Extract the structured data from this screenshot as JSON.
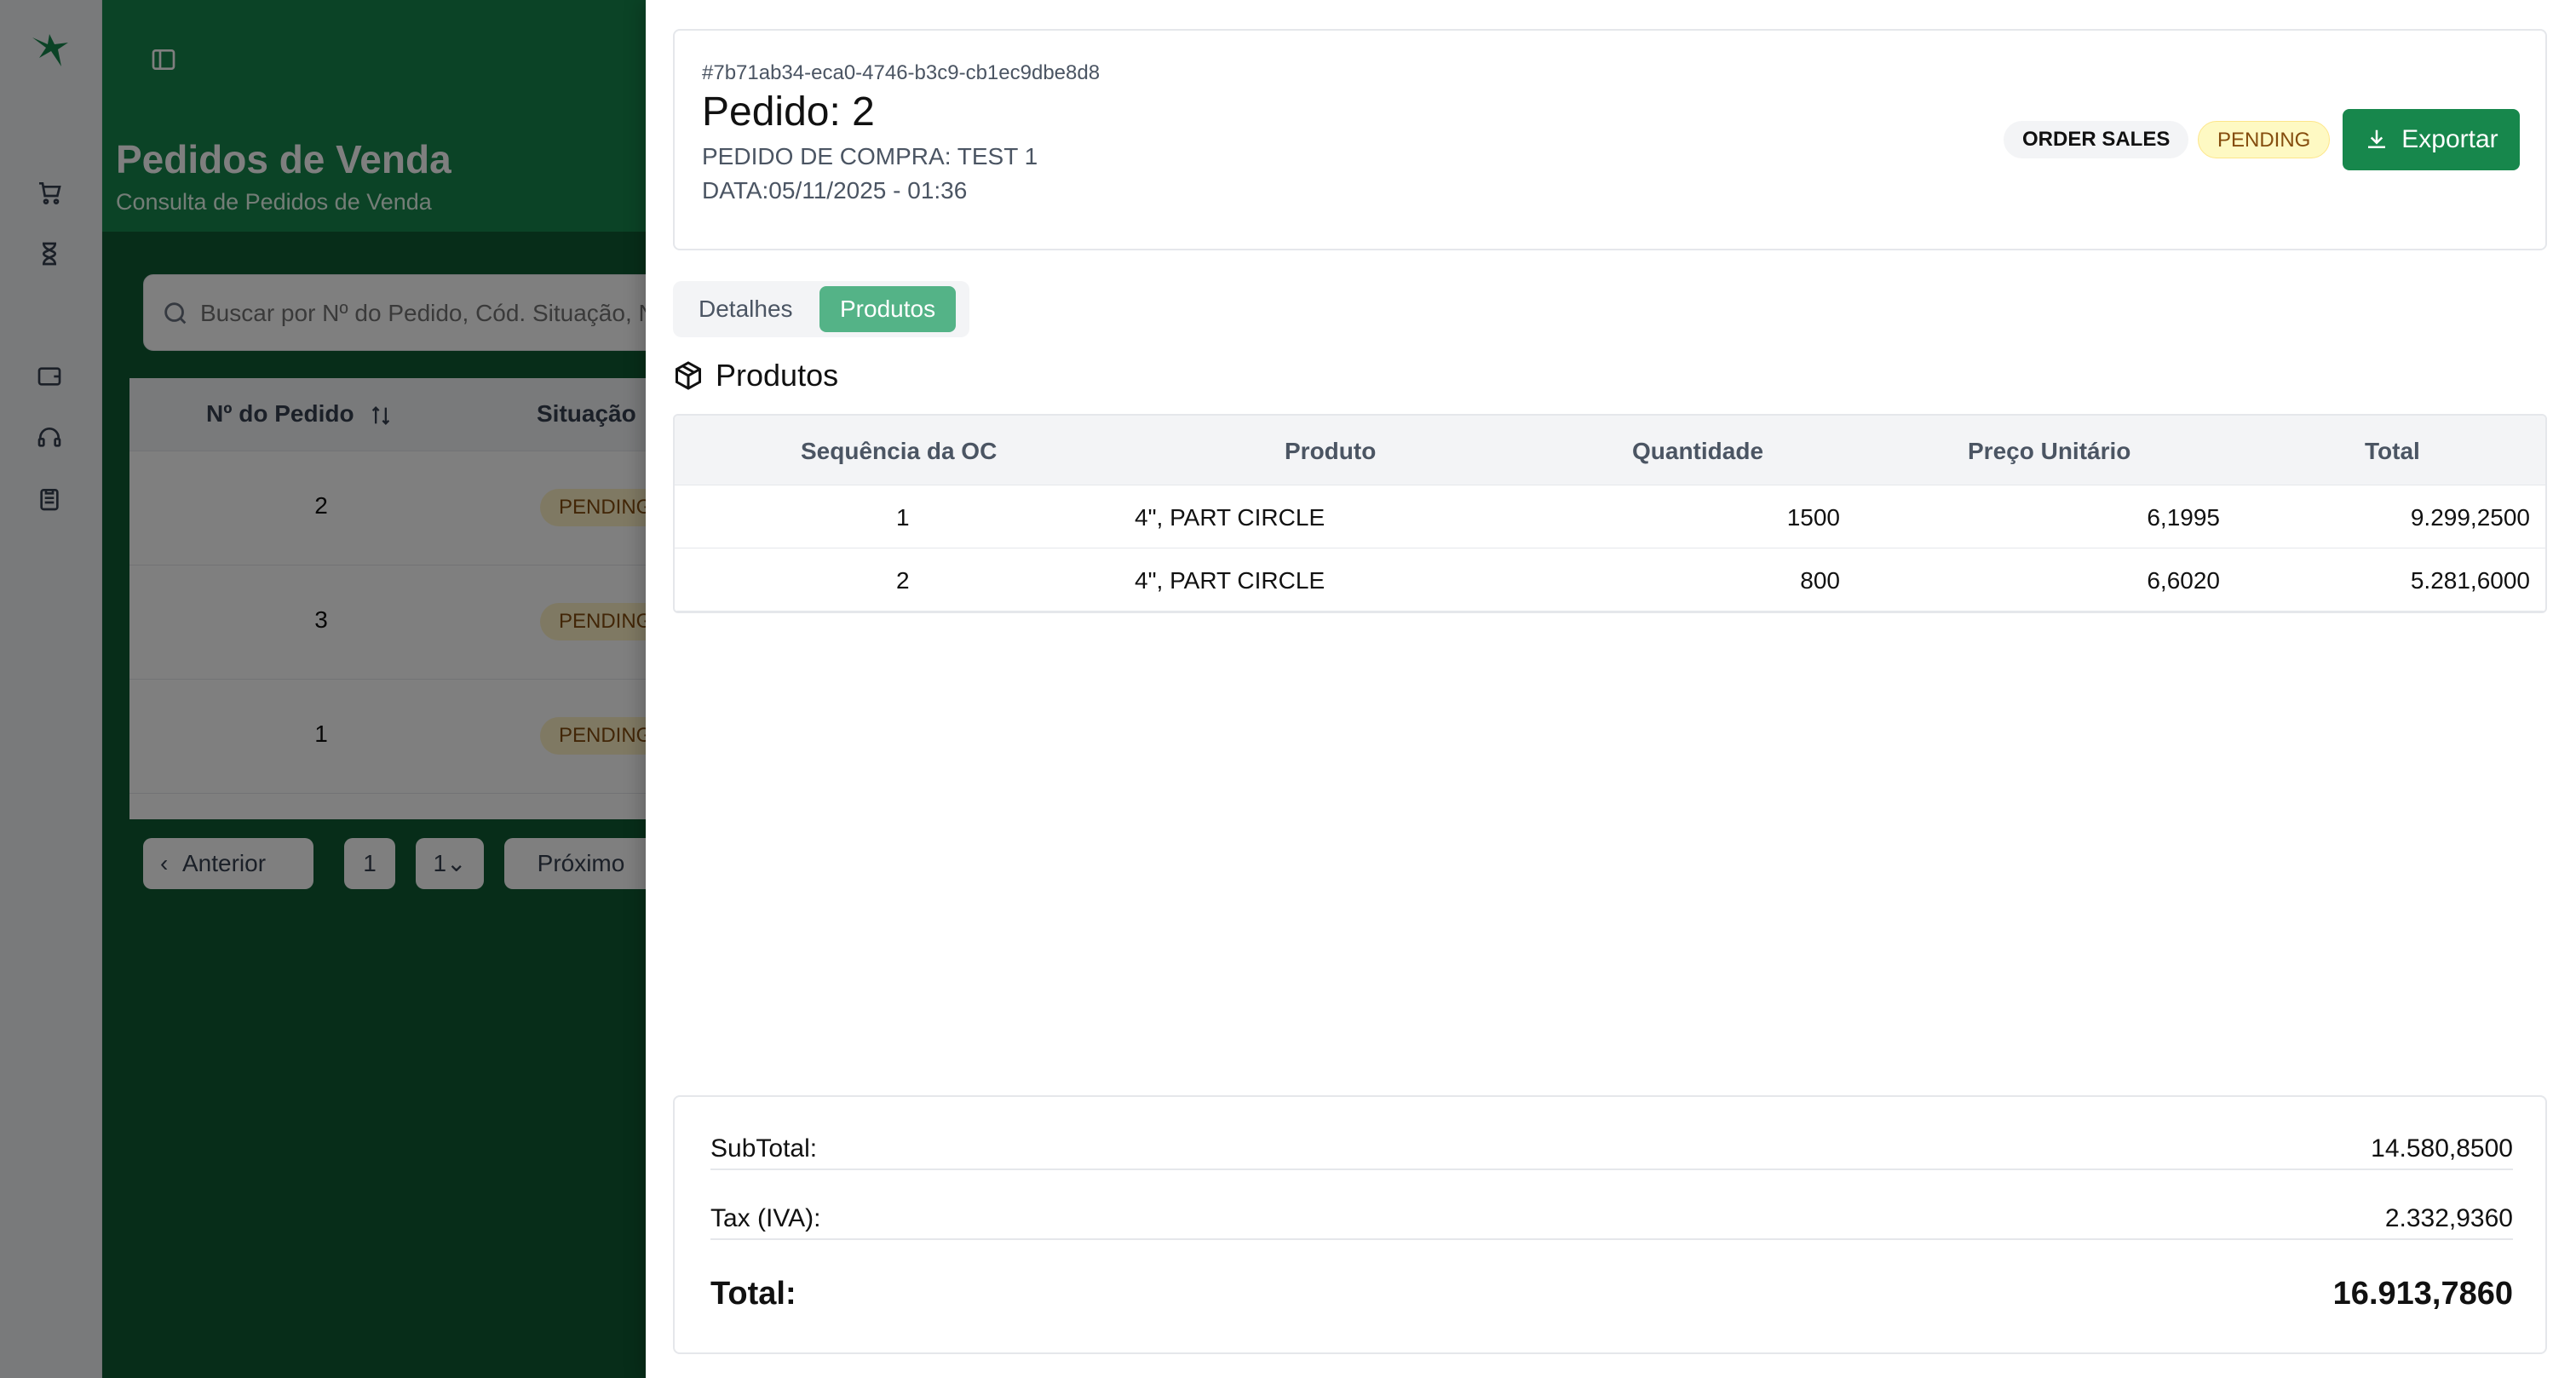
{
  "background": {
    "page_title": "Pedidos de Venda",
    "page_subtitle": "Consulta de Pedidos de Venda",
    "search_placeholder": "Buscar por Nº do Pedido, Cód. Situação, Número...",
    "table": {
      "col_order": "Nº do Pedido",
      "col_status": "Situação",
      "rows": [
        {
          "num": "2",
          "status": "PENDING"
        },
        {
          "num": "3",
          "status": "PENDING"
        },
        {
          "num": "1",
          "status": "PENDING"
        }
      ]
    },
    "pager": {
      "prev": "Anterior",
      "page": "1",
      "page_select": "1",
      "next": "Próximo"
    }
  },
  "order": {
    "id": "#7b71ab34-eca0-4746-b3c9-cb1ec9dbe8d8",
    "title": "Pedido: 2",
    "purchase_order": "PEDIDO DE COMPRA: TEST 1",
    "date": "DATA:05/11/2025 - 01:36",
    "type_chip": "ORDER SALES",
    "status_chip": "PENDING",
    "export_label": "Exportar"
  },
  "tabs": {
    "detalhes": "Detalhes",
    "produtos": "Produtos",
    "active": "produtos"
  },
  "products": {
    "section_title": "Produtos",
    "headers": {
      "seq": "Sequência da OC",
      "product": "Produto",
      "qty": "Quantidade",
      "unit_price": "Preço Unitário",
      "total": "Total"
    },
    "rows": [
      {
        "seq": "1",
        "product": "4\", PART CIRCLE",
        "qty": "1500",
        "unit_price": "6,1995",
        "total": "9.299,2500"
      },
      {
        "seq": "2",
        "product": "4\", PART CIRCLE",
        "qty": "800",
        "unit_price": "6,6020",
        "total": "5.281,6000"
      }
    ]
  },
  "totals": {
    "subtotal_label": "SubTotal:",
    "subtotal_value": "14.580,8500",
    "tax_label": "Tax (IVA):",
    "tax_value": "2.332,9360",
    "total_label": "Total:",
    "total_value": "16.913,7860"
  },
  "colors": {
    "brand_green": "#17874c",
    "tab_active": "#54b387",
    "pending_bg": "#fef9c3"
  }
}
